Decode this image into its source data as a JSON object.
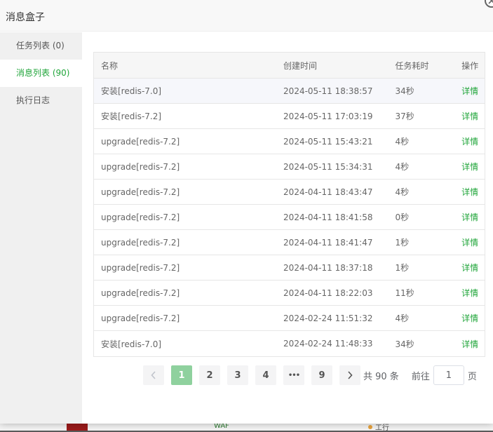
{
  "dialog": {
    "title": "消息盒子"
  },
  "sidebar": {
    "items": [
      {
        "label": "任务列表 (0)"
      },
      {
        "label": "消息列表 (90)"
      },
      {
        "label": "执行日志"
      }
    ]
  },
  "table": {
    "headers": [
      "名称",
      "创建时间",
      "任务耗时",
      "操作"
    ],
    "rows": [
      {
        "name": "安装[redis-7.0]",
        "created": "2024-05-11 18:38:57",
        "duration": "34秒",
        "action": "详情"
      },
      {
        "name": "安装[redis-7.2]",
        "created": "2024-05-11 17:03:19",
        "duration": "37秒",
        "action": "详情"
      },
      {
        "name": "upgrade[redis-7.2]",
        "created": "2024-05-11 15:43:21",
        "duration": "4秒",
        "action": "详情"
      },
      {
        "name": "upgrade[redis-7.2]",
        "created": "2024-05-11 15:34:31",
        "duration": "4秒",
        "action": "详情"
      },
      {
        "name": "upgrade[redis-7.2]",
        "created": "2024-04-11 18:43:47",
        "duration": "4秒",
        "action": "详情"
      },
      {
        "name": "upgrade[redis-7.2]",
        "created": "2024-04-11 18:41:58",
        "duration": "0秒",
        "action": "详情"
      },
      {
        "name": "upgrade[redis-7.2]",
        "created": "2024-04-11 18:41:47",
        "duration": "1秒",
        "action": "详情"
      },
      {
        "name": "upgrade[redis-7.2]",
        "created": "2024-04-11 18:37:18",
        "duration": "1秒",
        "action": "详情"
      },
      {
        "name": "upgrade[redis-7.2]",
        "created": "2024-04-11 18:22:03",
        "duration": "11秒",
        "action": "详情"
      },
      {
        "name": "upgrade[redis-7.2]",
        "created": "2024-02-24 11:51:32",
        "duration": "4秒",
        "action": "详情"
      },
      {
        "name": "安装[redis-7.0]",
        "created": "2024-02-24 11:48:33",
        "duration": "34秒",
        "action": "详情"
      }
    ]
  },
  "pagination": {
    "prev_icon": "chevron-left-icon",
    "next_icon": "chevron-right-icon",
    "pages": [
      "1",
      "2",
      "3",
      "4",
      "•••",
      "9"
    ],
    "current": "1",
    "total_text": "共 90 条",
    "goto_label": "前往",
    "goto_value": "1",
    "page_unit": "页"
  },
  "background": {
    "snippet_1": "WAF",
    "snippet_2": "工行"
  },
  "colors": {
    "accent": "#20a53a",
    "active_page": "#8fd19e"
  }
}
